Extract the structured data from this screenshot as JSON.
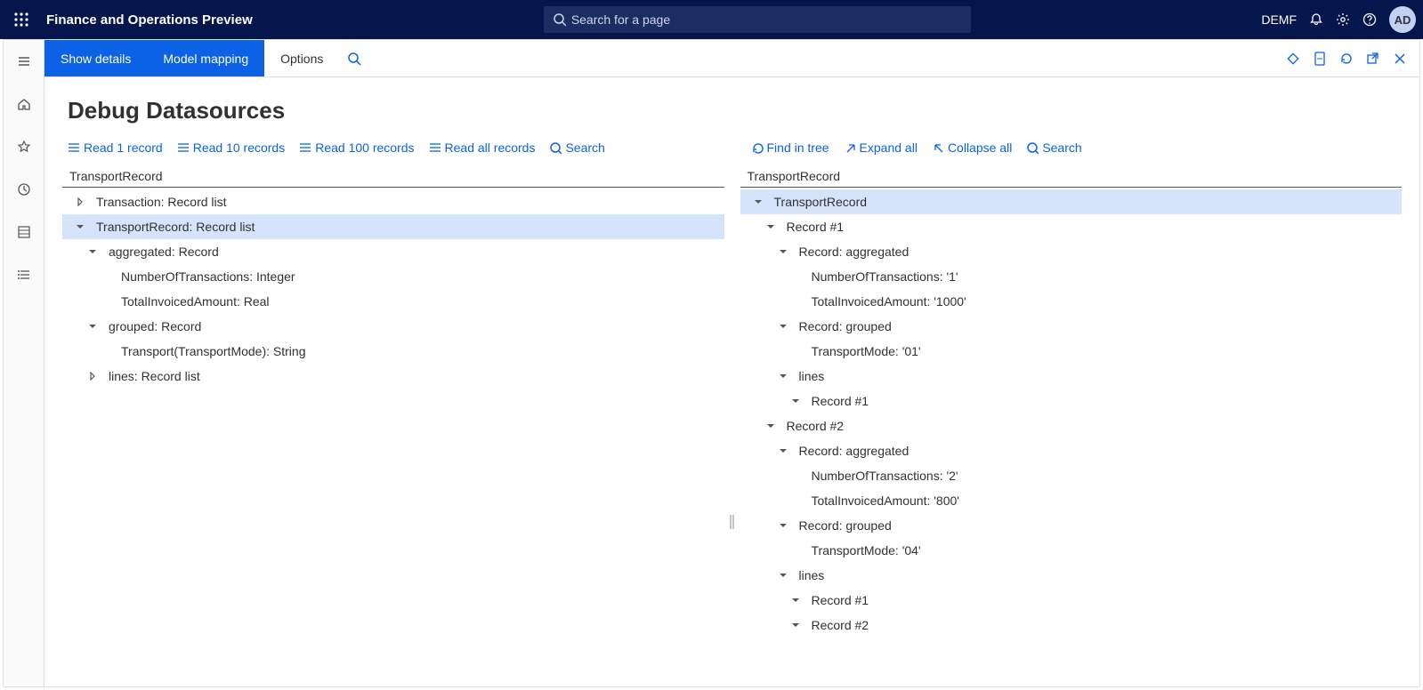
{
  "topbar": {
    "app_title": "Finance and Operations Preview",
    "search_placeholder": "Search for a page",
    "company": "DEMF",
    "avatar_initials": "AD"
  },
  "actionbar": {
    "show_details": "Show details",
    "model_mapping": "Model mapping",
    "options": "Options"
  },
  "page": {
    "title": "Debug Datasources"
  },
  "left_toolbar": {
    "read_1": "Read 1 record",
    "read_10": "Read 10 records",
    "read_100": "Read 100 records",
    "read_all": "Read all records",
    "search": "Search"
  },
  "right_toolbar": {
    "find_in_tree": "Find in tree",
    "expand_all": "Expand all",
    "collapse_all": "Collapse all",
    "search": "Search"
  },
  "left_panel": {
    "header": "TransportRecord",
    "tree": [
      {
        "indent": 0,
        "caret": "closed",
        "label": "Transaction: Record list",
        "selected": false
      },
      {
        "indent": 0,
        "caret": "open",
        "label": "TransportRecord: Record list",
        "selected": true
      },
      {
        "indent": 1,
        "caret": "open",
        "label": "aggregated: Record"
      },
      {
        "indent": 2,
        "caret": "none",
        "label": "NumberOfTransactions: Integer"
      },
      {
        "indent": 2,
        "caret": "none",
        "label": "TotalInvoicedAmount: Real"
      },
      {
        "indent": 1,
        "caret": "open",
        "label": "grouped: Record"
      },
      {
        "indent": 2,
        "caret": "none",
        "label": "Transport(TransportMode): String"
      },
      {
        "indent": 1,
        "caret": "closed",
        "label": "lines: Record list"
      }
    ]
  },
  "right_panel": {
    "header": "TransportRecord",
    "tree": [
      {
        "indent": 0,
        "caret": "open",
        "label": "TransportRecord",
        "selected": true
      },
      {
        "indent": 1,
        "caret": "open",
        "label": "Record #1"
      },
      {
        "indent": 2,
        "caret": "open",
        "label": "Record: aggregated"
      },
      {
        "indent": 3,
        "caret": "none",
        "label": "NumberOfTransactions: '1'"
      },
      {
        "indent": 3,
        "caret": "none",
        "label": "TotalInvoicedAmount: '1000'"
      },
      {
        "indent": 2,
        "caret": "open",
        "label": "Record: grouped"
      },
      {
        "indent": 3,
        "caret": "none",
        "label": "TransportMode: '01'"
      },
      {
        "indent": 2,
        "caret": "open",
        "label": "lines"
      },
      {
        "indent": 3,
        "caret": "open",
        "label": "Record #1"
      },
      {
        "indent": 1,
        "caret": "open",
        "label": "Record #2"
      },
      {
        "indent": 2,
        "caret": "open",
        "label": "Record: aggregated"
      },
      {
        "indent": 3,
        "caret": "none",
        "label": "NumberOfTransactions: '2'"
      },
      {
        "indent": 3,
        "caret": "none",
        "label": "TotalInvoicedAmount: '800'"
      },
      {
        "indent": 2,
        "caret": "open",
        "label": "Record: grouped"
      },
      {
        "indent": 3,
        "caret": "none",
        "label": "TransportMode: '04'"
      },
      {
        "indent": 2,
        "caret": "open",
        "label": "lines"
      },
      {
        "indent": 3,
        "caret": "open",
        "label": "Record #1"
      },
      {
        "indent": 3,
        "caret": "open",
        "label": "Record #2"
      }
    ]
  }
}
